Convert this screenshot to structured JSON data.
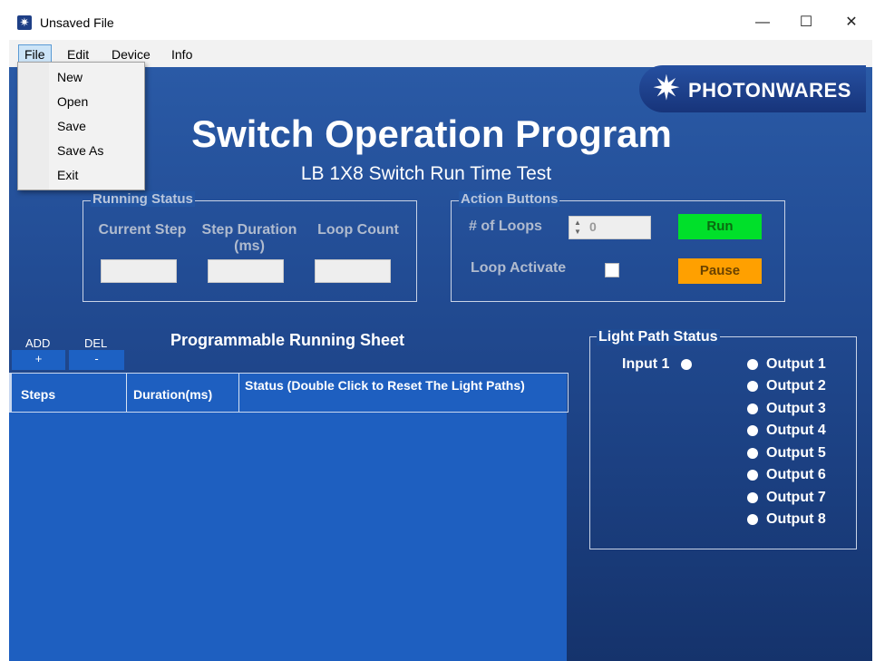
{
  "window": {
    "title": "Unsaved File",
    "minimize": "—",
    "maximize": "☐",
    "close": "✕"
  },
  "menu": {
    "items": [
      "File",
      "Edit",
      "Device",
      "Info"
    ]
  },
  "file_menu": {
    "items": [
      "New",
      "Open",
      "Save",
      "Save As",
      "Exit"
    ]
  },
  "logo": {
    "text": "PHOTONWARES"
  },
  "header": {
    "title": "Switch Operation Program",
    "subtitle": "LB 1X8 Switch Run Time Test"
  },
  "running_status": {
    "label": "Running Status",
    "current_step": "Current Step",
    "step_duration": "Step Duration (ms)",
    "loop_count": "Loop Count"
  },
  "action_buttons": {
    "label": "Action Buttons",
    "loops_label": "# of Loops",
    "loops_value": "0",
    "run": "Run",
    "loop_activate": "Loop Activate",
    "pause": "Pause"
  },
  "sheet": {
    "add_label": "ADD",
    "add_button": "+",
    "del_label": "DEL",
    "del_button": "-",
    "title": "Programmable Running Sheet",
    "columns": [
      "Steps",
      "Duration(ms)",
      "Status (Double Click to Reset The Light Paths)"
    ]
  },
  "light_path": {
    "label": "Light Path Status",
    "input": "Input 1",
    "outputs": [
      "Output 1",
      "Output 2",
      "Output 3",
      "Output 4",
      "Output 5",
      "Output 6",
      "Output 7",
      "Output 8"
    ]
  },
  "colors": {
    "run_button": "#00e02a",
    "pause_button": "#ffa000",
    "grid_bg": "#1e5fc0"
  }
}
